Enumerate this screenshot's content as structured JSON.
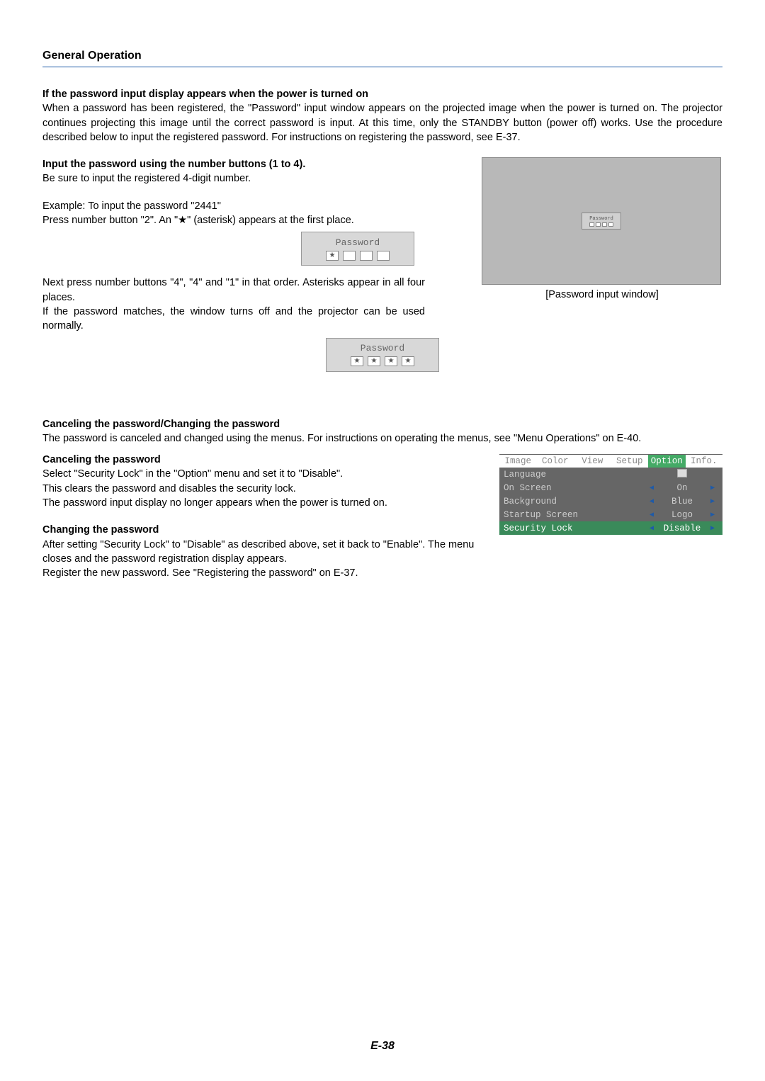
{
  "section_title": "General Operation",
  "h1": "If the password input display appears when the power is turned on",
  "p1": "When a password has been registered, the \"Password\" input window appears on the projected image when the power is turned on. The projector continues projecting this image until the correct password is input. At this time, only the STANDBY button (power off) works. Use the procedure described below to input the registered password. For instructions on registering the password, see E-37.",
  "h2": "Input the password using the number buttons (1 to 4).",
  "p2a": "Be sure to input the registered 4-digit number.",
  "p2b": "Example: To input the password \"2441\"",
  "p2c": "Press number button \"2\". An \"★\" (asterisk) appears at the first place.",
  "p2d": "Next press number buttons \"4\", \"4\" and \"1\" in that order. Asterisks appear in all four places.",
  "p2e": "If the password matches, the window turns off and the projector can be used normally.",
  "screenshot_caption": "[Password input window]",
  "pw_label": "Password",
  "pw_dialog1_cells": [
    "★",
    "",
    "",
    ""
  ],
  "pw_dialog2_cells": [
    "★",
    "★",
    "★",
    "★"
  ],
  "h3": "Canceling the password/Changing the password",
  "p3": "The password is canceled and changed using the menus. For instructions on operating the menus, see \"Menu Operations\" on E-40.",
  "h4": "Canceling the password",
  "p4a": "Select \"Security Lock\" in the \"Option\" menu and set it to \"Disable\".",
  "p4b": "This clears the password and disables the security lock.",
  "p4c": "The password input display no longer appears when the power is turned on.",
  "h5": "Changing the password",
  "p5a": "After setting \"Security Lock\" to \"Disable\" as described above, set it back to \"Enable\". The menu closes and the password registration display appears.",
  "p5b": "Register the new password. See \"Registering the password\" on E-37.",
  "menu": {
    "tabs": [
      "Image",
      "Color",
      "View",
      "Setup",
      "Option",
      "Info."
    ],
    "active_tab": "Option",
    "rows": [
      {
        "key": "Language",
        "value": "",
        "enter": true
      },
      {
        "key": "On Screen",
        "value": "On"
      },
      {
        "key": "Background",
        "value": "Blue"
      },
      {
        "key": "Startup Screen",
        "value": "Logo"
      },
      {
        "key": "Security Lock",
        "value": "Disable",
        "selected": true
      }
    ]
  },
  "page_number": "E-38"
}
